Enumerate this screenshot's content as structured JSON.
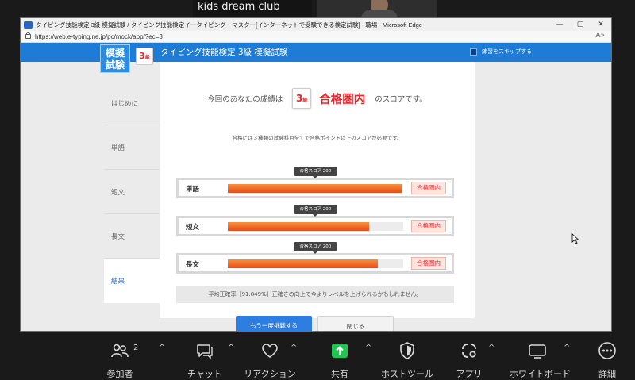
{
  "zoom": {
    "participant_name": "kids dream club"
  },
  "browser": {
    "title": "タイピング技能検定 3級 模擬試験 / タイピング技能検定イータイピング・マスター[インターネットで受験できる検定試験] - 職場 - Microsoft Edge",
    "url": "https://web.e-typing.ne.jp/pc/mock/app/?ec=3",
    "controls": {
      "minimize": "—",
      "maximize": "▢",
      "close": "✕"
    },
    "read_aloud": "A»"
  },
  "app": {
    "logo_text": [
      "模擬",
      "試験"
    ],
    "grade_badge": {
      "num": "3",
      "unit": "級"
    },
    "header_title": "タイピング技能検定 3級 模擬試験",
    "skip_label": "練習をスキップする"
  },
  "sidebar": {
    "items": [
      {
        "label": "はじめに"
      },
      {
        "label": "単語"
      },
      {
        "label": "短文"
      },
      {
        "label": "長文"
      },
      {
        "label": "結果"
      }
    ]
  },
  "result": {
    "before": "今回のあなたの成績は",
    "badge": {
      "num": "3",
      "unit": "級"
    },
    "status": "合格圏内",
    "after": "のスコアです。",
    "note": "合格には３種類の試験科目全てで合格ポイント以上のスコアが必要です。",
    "rows": [
      {
        "label": "単語",
        "progress": 0.993,
        "pass_marker": 0.5,
        "tooltip": "合格スコア 200",
        "status": "合格圏内"
      },
      {
        "label": "短文",
        "progress": 0.807,
        "pass_marker": 0.5,
        "tooltip": "合格スコア 200",
        "status": "合格圏内"
      },
      {
        "label": "長文",
        "progress": 0.857,
        "pass_marker": 0.5,
        "tooltip": "合格スコア 200",
        "status": "合格圏内"
      }
    ],
    "accuracy_text": "平均正確率［91.849%］正確さの向上で今よりレベルを上げられるかもしれません。",
    "retry_label": "もう一度挑戦する",
    "close_label": "閉じる"
  },
  "toolbar": {
    "participants": {
      "label": "参加者",
      "count": "2"
    },
    "chat": {
      "label": "チャット"
    },
    "reactions": {
      "label": "リアクション"
    },
    "share": {
      "label": "共有"
    },
    "host_tools": {
      "label": "ホストツール"
    },
    "apps": {
      "label": "アプリ"
    },
    "whiteboard": {
      "label": "ホワイトボード"
    },
    "more": {
      "label": "詳細"
    },
    "caret": "^"
  },
  "colors": {
    "header_blue": "#1e7bd6",
    "pass_red": "#e8282d",
    "bar_orange": "#f07a2c",
    "share_green": "#23c552"
  }
}
